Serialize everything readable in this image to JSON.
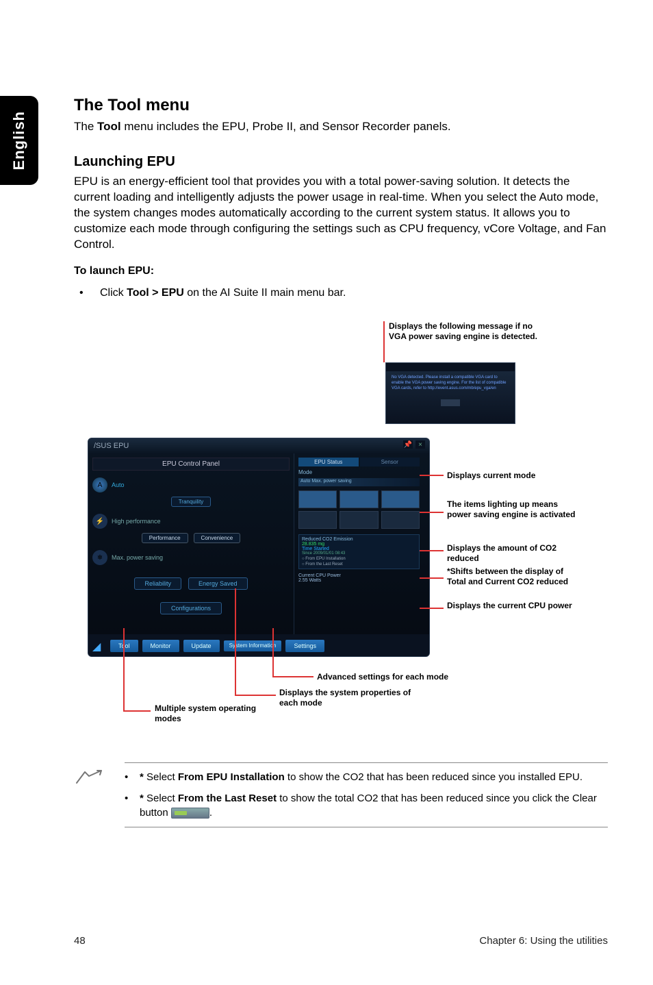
{
  "sidebar": {
    "label": "English"
  },
  "headings": {
    "tool_menu": "The Tool menu",
    "tool_menu_desc_pre": "The ",
    "tool_menu_desc_bold": "Tool",
    "tool_menu_desc_post": " menu includes the EPU, Probe II, and Sensor Recorder panels.",
    "launching_epu": "Launching EPU",
    "epu_desc": "EPU is an energy-efficient tool that provides you with a total power-saving solution. It detects the current loading and intelligently adjusts the power usage in real-time. When you select the Auto mode, the system changes modes automatically according to the current system status. It allows you to customize each mode through configuring the settings such as CPU frequency, vCore Voltage, and Fan Control.",
    "to_launch": "To launch EPU:",
    "bullet_pre": "Click ",
    "bullet_bold": "Tool > EPU",
    "bullet_post": " on the AI Suite II main menu bar."
  },
  "callouts": {
    "no_vga": "Displays the following message if no VGA power saving engine is detected.",
    "current_mode": "Displays current mode",
    "items_light": "The items lighting up means power saving engine is activated",
    "co2_reduced": "Displays the amount of CO2 reduced",
    "shifts": "*Shifts between the display of Total and Current CO2 reduced",
    "cpu_power": "Displays the current CPU power",
    "advanced": "Advanced settings for each mode",
    "sys_props": "Displays the system properties of each mode",
    "multi_modes": "Multiple system operating modes"
  },
  "app": {
    "brand": "/SUS",
    "title": "EPU",
    "control_panel": "EPU Control Panel",
    "modes": {
      "auto": "Auto",
      "high": "High performance",
      "max": "Max. power saving"
    },
    "pills": {
      "tranquility": "Tranquility",
      "performance": "Performance",
      "convenience": "Convenience"
    },
    "buttons": {
      "reliability": "Reliability",
      "energy": "Energy Saved",
      "config": "Configurations"
    },
    "right": {
      "tab1": "EPU Status",
      "tab2": "Sensor",
      "mode_label": "Mode",
      "mode_value": "Auto Max. power saving",
      "co2_title": "Reduced CO2 Emission",
      "co2_value": "28.835 mg",
      "time_started": "Time Started",
      "since": "Since 2009/01/01 08:43",
      "opt1": "From EPU Installation",
      "opt2": "From the Last Reset",
      "cpu_label": "Current CPU Power",
      "cpu_value": "2.55 Watts"
    },
    "bottom": {
      "tool": "Tool",
      "monitor": "Monitor",
      "update": "Update",
      "sysinfo": "System Information",
      "settings": "Settings"
    }
  },
  "notes": {
    "n1_pre": "*",
    "n1_mid1": " Select ",
    "n1_bold": "From EPU Installation",
    "n1_post": " to show the CO2 that has been reduced since you installed EPU.",
    "n2_pre": "*",
    "n2_mid1": " Select ",
    "n2_bold": "From the Last Reset",
    "n2_post1": " to show the total CO2 that has been reduced since you click the Clear button ",
    "n2_post2": "."
  },
  "footer": {
    "page": "48",
    "chapter": "Chapter 6: Using the utilities"
  }
}
